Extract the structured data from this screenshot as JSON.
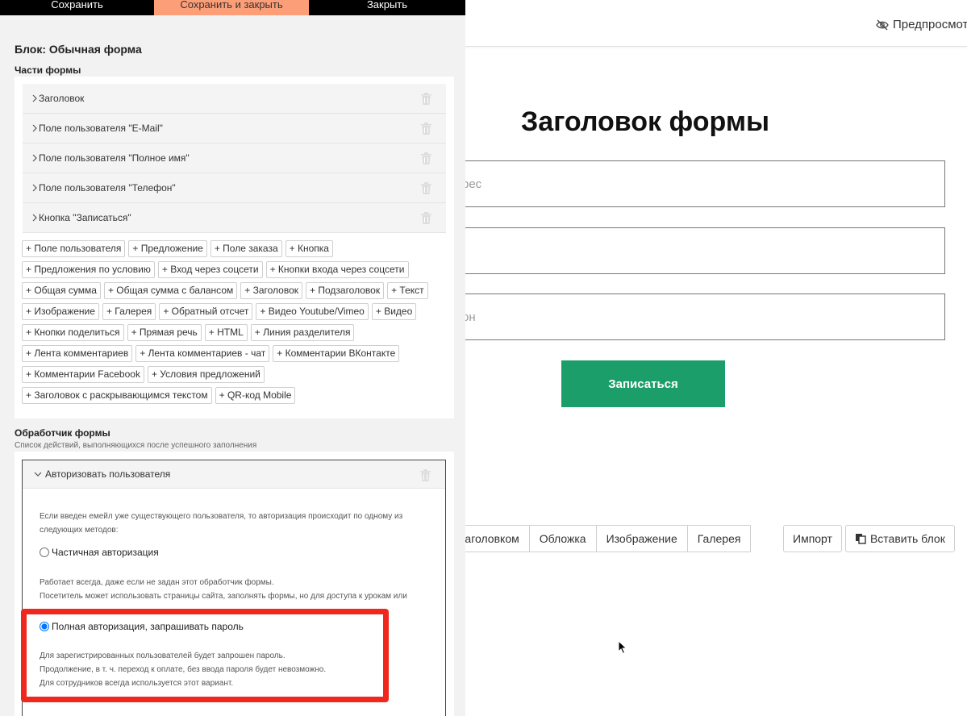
{
  "toolbar": {
    "save_label": "Сохранить",
    "save_close_label": "Сохранить и закрыть",
    "close_label": "Закрыть"
  },
  "editor": {
    "block_title": "Блок: Обычная форма",
    "parts_title": "Части формы",
    "parts": [
      "Заголовок",
      "Поле пользователя \"E-Mail\"",
      "Поле пользователя \"Полное имя\"",
      "Поле пользователя \"Телефон\"",
      "Кнопка \"Записаться\""
    ],
    "add_buttons": [
      "+ Поле пользователя",
      "+ Предложение",
      "+ Поле заказа",
      "+ Кнопка",
      "+ Предложения по условию",
      "+ Вход через соцсети",
      "+ Кнопки входа через соцсети",
      "+ Общая сумма",
      "+ Общая сумма с балансом",
      "+ Заголовок",
      "+ Подзаголовок",
      "+ Текст",
      "+ Изображение",
      "+ Галерея",
      "+ Обратный отсчет",
      "+ Видео Youtube/Vimeo",
      "+ Видео",
      "+ Кнопки поделиться",
      "+ Прямая речь",
      "+ HTML",
      "+ Линия разделителя",
      "+ Лента комментариев",
      "+ Лента комментариев - чат",
      "+ Комментарии ВКонтакте",
      "+ Комментарии Facebook",
      "+ Условия предложений",
      "+ Заголовок с раскрывающимся текстом",
      "+ QR-код Mobile"
    ],
    "handler": {
      "title": "Обработчик формы",
      "subtitle": "Список действий, выполняющихся после успешного заполнения",
      "item_title": "Авторизовать пользователя",
      "description_1": "Если введен емейл уже существующего пользователя, то авторизация происходит по одному из",
      "description_2": "следующих методов:",
      "option_partial": "Частичная авторизация",
      "partial_desc_1": "Работает всегда, даже если не задан этот обработчик формы.",
      "partial_desc_2": "Посетитель может использовать страницы сайта, заполнять формы, но для доступа к урокам или",
      "option_full": "Полная авторизация, запрашивать пароль",
      "full_desc_1": "Для зарегистрированных пользователей будет запрошен пароль.",
      "full_desc_2": "Продолжение, в т. ч. переход к оплате, без ввода пароля будет невозможно.",
      "full_desc_3": "Для сотрудников всегда используется этот вариант."
    }
  },
  "preview": {
    "toggle_label": "Предпросмотр",
    "form_title": "Заголовок формы",
    "email_placeholder": "рес",
    "name_placeholder": "",
    "phone_placeholder": "он",
    "submit_label": "Записаться",
    "block_bar": [
      "заголовком",
      "Обложка",
      "Изображение",
      "Галерея"
    ],
    "import_label": "Импорт",
    "paste_label": "Вставить блок"
  },
  "colors": {
    "accent_orange": "#fc9e77",
    "submit_green": "#1b9e69",
    "highlight_red": "#f0271c"
  }
}
